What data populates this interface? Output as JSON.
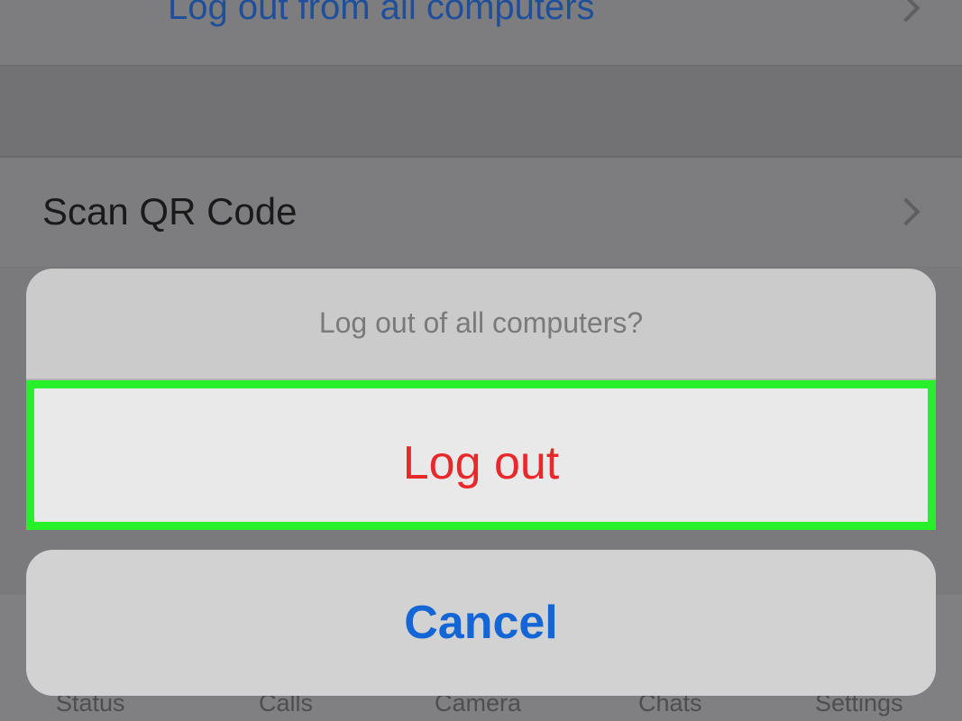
{
  "background_rows": {
    "logout_all_label": "Log out from all computers",
    "scan_qr_label": "Scan QR Code"
  },
  "tabbar": {
    "tabs": [
      "Status",
      "Calls",
      "Camera",
      "Chats",
      "Settings"
    ]
  },
  "action_sheet": {
    "title": "Log out of all computers?",
    "logout_label": "Log out",
    "cancel_label": "Cancel"
  },
  "colors": {
    "destructive": "#e8282b",
    "cancel": "#1466d6",
    "highlight": "#27f02a"
  }
}
